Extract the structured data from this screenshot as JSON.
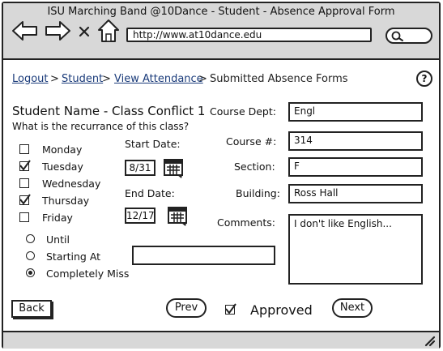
{
  "window": {
    "title": "ISU Marching Band @10Dance - Student - Absence Approval Form"
  },
  "browser": {
    "url": "http://www.at10dance.edu",
    "back_icon": "arrow-left-icon",
    "forward_icon": "arrow-right-icon",
    "stop_icon": "close-icon",
    "home_icon": "home-icon",
    "search_icon": "search-icon"
  },
  "breadcrumb": {
    "items": [
      "Logout",
      "Student",
      "View Attendance"
    ],
    "separator": ">",
    "current": "Submitted Absence Forms"
  },
  "help": {
    "label": "?"
  },
  "form": {
    "heading": "Student Name - Class Conflict 1",
    "question": "What is the recurrance of this class?",
    "days": [
      {
        "label": "Monday",
        "checked": false
      },
      {
        "label": "Tuesday",
        "checked": true
      },
      {
        "label": "Wednesday",
        "checked": false
      },
      {
        "label": "Thursday",
        "checked": true
      },
      {
        "label": "Friday",
        "checked": false
      }
    ],
    "start_date": {
      "label": "Start Date:",
      "value": "8/31"
    },
    "end_date": {
      "label": "End Date:",
      "value": "12/17"
    },
    "radios": [
      {
        "label": "Until",
        "selected": false
      },
      {
        "label": "Starting At",
        "selected": false
      },
      {
        "label": "Completely Miss",
        "selected": true
      }
    ],
    "starting_at_value": "",
    "course_dept": {
      "label": "Course Dept:",
      "value": "Engl"
    },
    "course_num": {
      "label": "Course #:",
      "value": "314"
    },
    "section": {
      "label": "Section:",
      "value": "F"
    },
    "building": {
      "label": "Building:",
      "value": "Ross Hall"
    },
    "comments": {
      "label": "Comments:",
      "value": "I don't like English..."
    }
  },
  "actions": {
    "back": "Back",
    "prev": "Prev",
    "approved_label": "Approved",
    "approved_checked": true,
    "next": "Next"
  }
}
